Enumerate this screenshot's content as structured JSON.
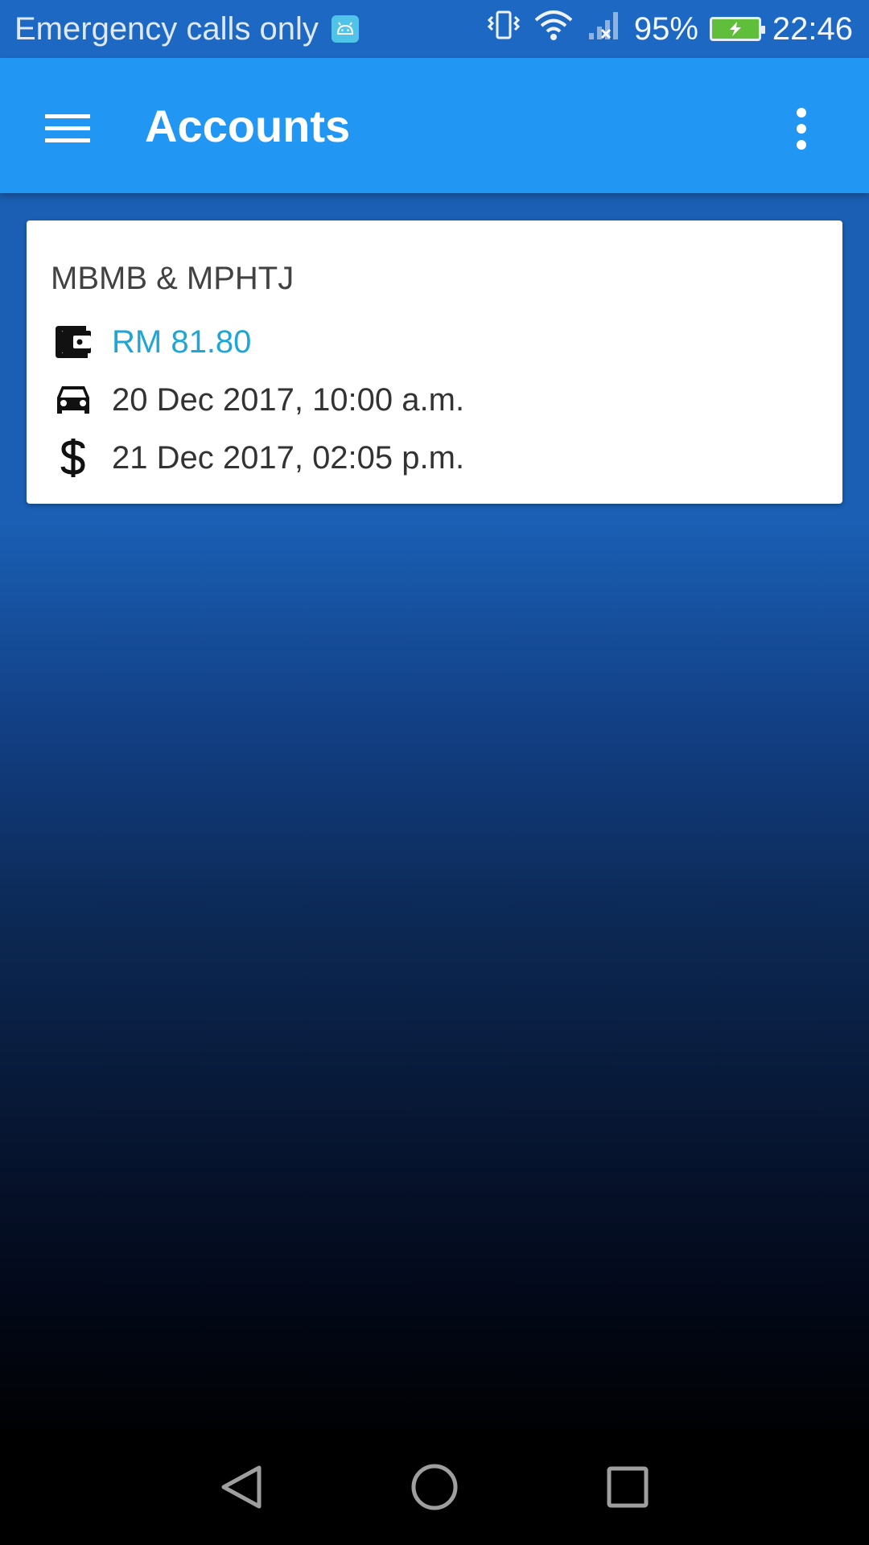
{
  "status_bar": {
    "carrier_text": "Emergency calls only",
    "battery_percent": "95%",
    "time": "22:46",
    "icons": [
      "android-notification-icon",
      "vibrate-icon",
      "wifi-icon",
      "no-signal-icon",
      "battery-charging-icon"
    ]
  },
  "app_bar": {
    "title": "Accounts",
    "background_color": "#2196f3"
  },
  "account_card": {
    "name": "MBMB & MPHTJ",
    "amount": "RM 81.80",
    "parking_datetime": "20 Dec 2017, 10:00 a.m.",
    "payment_datetime": "21 Dec 2017, 02:05 p.m.",
    "amount_color": "#1fa6d6",
    "icons": [
      "wallet-icon",
      "car-icon",
      "dollar-icon"
    ]
  },
  "nav_bar": {
    "icons": [
      "back-icon",
      "home-icon",
      "recents-icon"
    ]
  }
}
